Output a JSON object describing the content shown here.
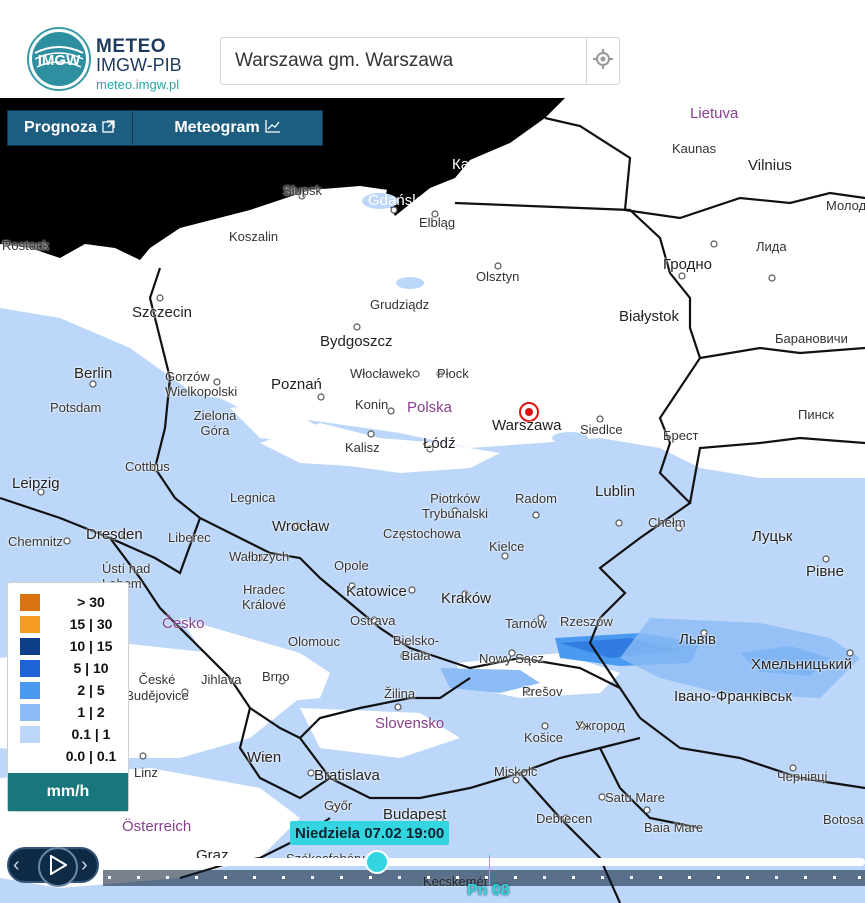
{
  "header": {
    "logo_text": "IMGW",
    "brand_title": "METEO",
    "brand_subtitle": "IMGW-PIB",
    "brand_url": "meteo.imgw.pl"
  },
  "search": {
    "value": "Warszawa gm. Warszawa",
    "locate_icon": "crosshair-icon"
  },
  "tabs": [
    {
      "label": "Prognoza",
      "icon": "external-link-icon"
    },
    {
      "label": "Meteogram",
      "icon": "chart-line-icon"
    }
  ],
  "map": {
    "countries": [
      "Lietuva",
      "Polska",
      "Česko",
      "Slovensko",
      "Österreich"
    ],
    "cities": [
      "Kaunas",
      "Vilnius",
      "Молод",
      "Калининград",
      "Słupsk",
      "Gdańsk",
      "Elbląg",
      "Rostock",
      "Koszalin",
      "Лида",
      "Гродно",
      "Olsztyn",
      "Grudziądz",
      "Szczecin",
      "Białystok",
      "Барановичи",
      "Bydgoszcz",
      "Berlin",
      "Gorzów Wielkopolski",
      "Poznań",
      "Włocławek",
      "Płock",
      "Potsdam",
      "Konin",
      "Warszawa",
      "Siedlce",
      "Пинск",
      "Zielona Góra",
      "Kalisz",
      "Łódź",
      "Брест",
      "Cottbus",
      "Leipzig",
      "Legnica",
      "Piotrków Trybunalski",
      "Radom",
      "Lublin",
      "Wrocław",
      "Chełm",
      "Chemnitz",
      "Dresden",
      "Liberec",
      "Częstochowa",
      "Kielce",
      "Луцьк",
      "Wałbrzych",
      "Ústí nad Labem",
      "Opole",
      "Рівне",
      "Hradec Králové",
      "Katowice",
      "Kraków",
      "Ostrava",
      "Tarnów",
      "Rzeszów",
      "Olomouc",
      "Bielsko-Biała",
      "Львів",
      "Nowy Sącz",
      "Хмельницький",
      "České Budějovice",
      "Jihlava",
      "Brno",
      "Prešov",
      "Івано-Франківськ",
      "Žilina",
      "Ужгород",
      "Košice",
      "Wien",
      "Bratislava",
      "Linz",
      "Miskolc",
      "Чернівці",
      "Satu Mare",
      "Győr",
      "Budapest",
      "Debrecen",
      "Baia Mare",
      "Botosa",
      "Székesfehérvár",
      "Graz",
      "Kecskemét"
    ],
    "selected_marker": "location-marker-icon"
  },
  "legend": {
    "items": [
      {
        "label": "> 30",
        "color": "#d9730f"
      },
      {
        "label": "15 | 30",
        "color": "#f39c1f"
      },
      {
        "label": "10 | 15",
        "color": "#0f3f8a"
      },
      {
        "label": "5 | 10",
        "color": "#1e64d6"
      },
      {
        "label": "2 | 5",
        "color": "#4a9af0"
      },
      {
        "label": "1 | 2",
        "color": "#8cbcf5"
      },
      {
        "label": "0.1 | 1",
        "color": "#bcd7fa"
      },
      {
        "label": "0.0 | 0.1",
        "color": "#ffffff"
      }
    ],
    "unit": "mm/h"
  },
  "timeline": {
    "current_time": "Niedziela 07.02 19:00",
    "next_day": "Pn 08",
    "prev_icon": "chevron-left-icon",
    "play_icon": "play-icon",
    "next_icon": "chevron-right-icon"
  },
  "colors": {
    "precip_light": "#bcd7fa",
    "precip_mid": "#8cbcf5",
    "accent": "#33d6e0",
    "tab_bg": "#1d5d80",
    "legend_unit_bg": "#17777c"
  }
}
